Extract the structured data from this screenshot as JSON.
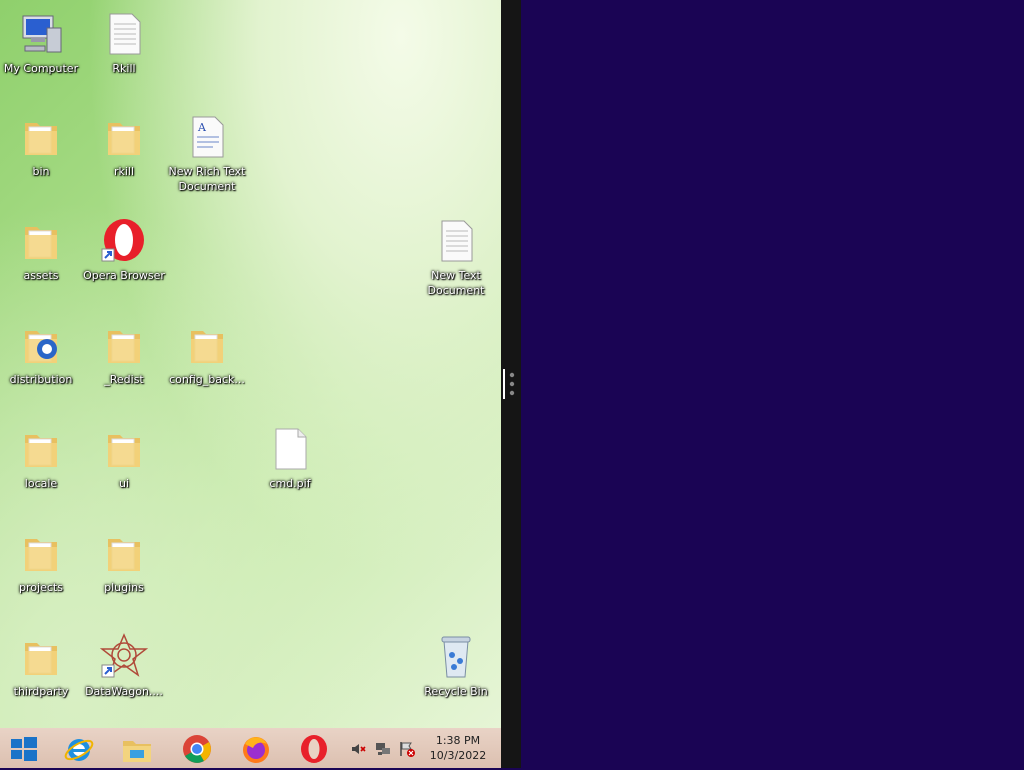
{
  "desktop": {
    "icons": [
      {
        "label": "My Computer",
        "type": "computer-icon"
      },
      {
        "label": "Rkill",
        "type": "text-file-icon"
      },
      {
        "label": "bin",
        "type": "folder-icon"
      },
      {
        "label": "rkill",
        "type": "folder-icon"
      },
      {
        "label": "New Rich Text Document",
        "type": "rich-text-file-icon"
      },
      {
        "label": "assets",
        "type": "folder-icon"
      },
      {
        "label": "Opera Browser",
        "type": "opera-shortcut-icon"
      },
      {
        "label": "New Text Document",
        "type": "text-file-icon"
      },
      {
        "label": "distribution",
        "type": "folder-icon"
      },
      {
        "label": "_Redist",
        "type": "folder-icon"
      },
      {
        "label": "config_back...",
        "type": "folder-icon"
      },
      {
        "label": "locale",
        "type": "folder-icon"
      },
      {
        "label": "ui",
        "type": "folder-icon"
      },
      {
        "label": "cmd.pif",
        "type": "blank-file-icon"
      },
      {
        "label": "projects",
        "type": "folder-icon"
      },
      {
        "label": "plugins",
        "type": "folder-icon"
      },
      {
        "label": "thirdparty",
        "type": "folder-icon"
      },
      {
        "label": "DataWagon....",
        "type": "datawagon-shortcut-icon"
      },
      {
        "label": "Recycle Bin",
        "type": "recycle-bin-icon"
      }
    ]
  },
  "taskbar": {
    "start": "windows-start-icon",
    "pinned": [
      {
        "name": "Internet Explorer",
        "icon": "internet-explorer-icon"
      },
      {
        "name": "File Explorer",
        "icon": "file-explorer-icon"
      },
      {
        "name": "Google Chrome",
        "icon": "chrome-icon"
      },
      {
        "name": "Firefox",
        "icon": "firefox-icon"
      },
      {
        "name": "Opera",
        "icon": "opera-icon"
      }
    ],
    "tray": [
      "volume-muted-icon",
      "network-icon",
      "action-center-flag-icon"
    ],
    "clock": {
      "time": "1:38 PM",
      "date": "10/3/2022"
    }
  },
  "colors": {
    "right_pane": "#1a0454",
    "splitter": "#151515",
    "taskbar": "#e2c7b8"
  }
}
